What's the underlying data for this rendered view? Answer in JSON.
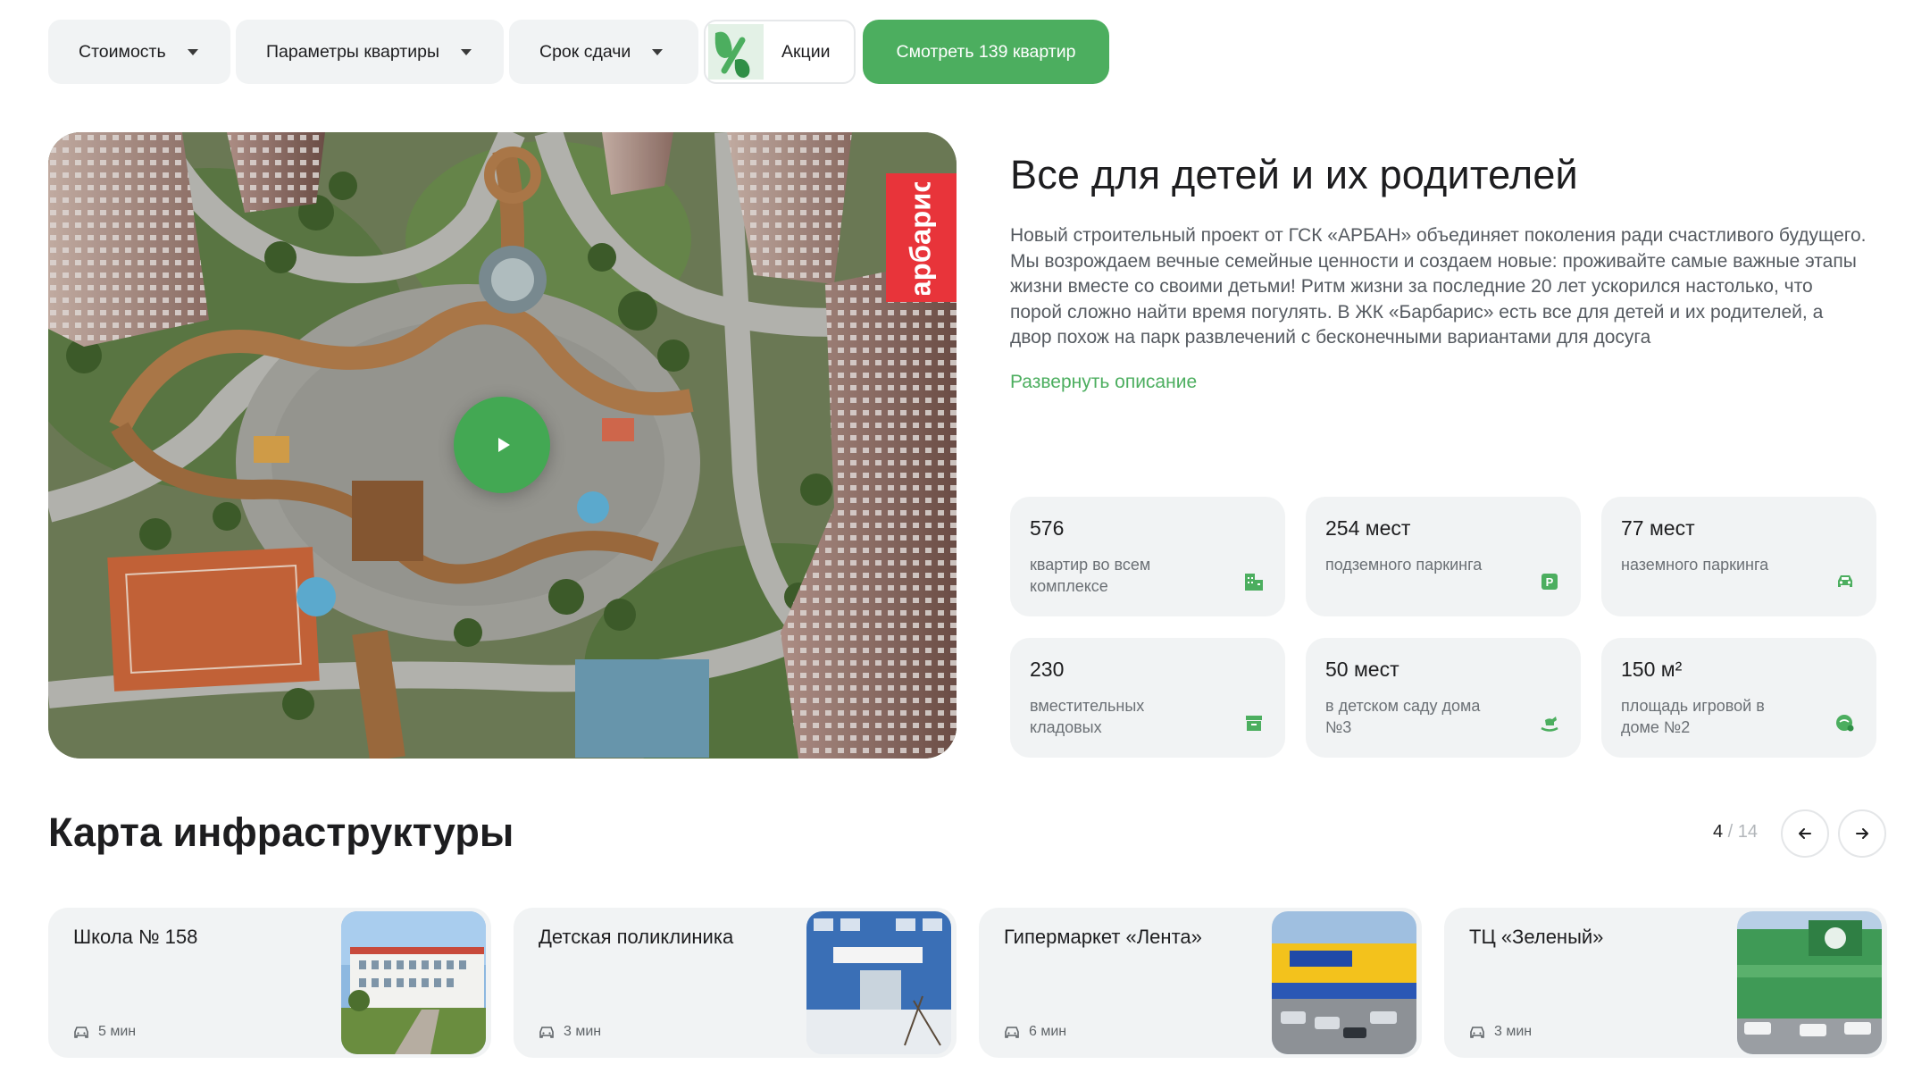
{
  "filters": {
    "cost_label": "Стоимость",
    "params_label": "Параметры квартиры",
    "term_label": "Срок сдачи",
    "promo_label": "Акции",
    "cta_label": "Смотреть 139 квартир"
  },
  "hero": {
    "brand_text": "барбарис"
  },
  "description": {
    "title": "Все для детей и их родителей",
    "body": "Новый строительный проект от ГСК «АРБАН» объединяет поколения ради счастливого будущего. Мы возрождаем вечные семейные ценности и создаем новые: проживайте самые важные этапы жизни вместе со своими детьми! Ритм жизни за последние 20 лет ускорился настолько, что порой сложно найти время погулять. В ЖК «Барбарис» есть все для детей и их родителей, а двор похож на парк развлечений с бесконечными вариантами для досуга",
    "expand_label": "Развернуть описание"
  },
  "stats": [
    {
      "value": "576",
      "label": "квартир во всем комплексе",
      "icon": "building-icon"
    },
    {
      "value": "254 мест",
      "label": "подземного паркинга",
      "icon": "parking-icon"
    },
    {
      "value": "77 мест",
      "label": "наземного паркинга",
      "icon": "car-icon"
    },
    {
      "value": "230",
      "label": "вместительных кладовых",
      "icon": "storage-icon"
    },
    {
      "value": "50 мест",
      "label": "в детском саду дома №3",
      "icon": "rocking-horse-icon"
    },
    {
      "value": "150 м²",
      "label": "площадь игровой в доме №2",
      "icon": "playground-icon"
    }
  ],
  "infrastructure": {
    "title": "Карта инфраструктуры",
    "pager_current": "4",
    "pager_sep": " / ",
    "pager_total": "14",
    "cards": [
      {
        "title": "Школа № 158",
        "time": "5 мин"
      },
      {
        "title": "Детская поликлиника",
        "time": "3 мин"
      },
      {
        "title": "Гипермаркет «Лента»",
        "time": "6 мин"
      },
      {
        "title": "ТЦ «Зеленый»",
        "time": "3 мин"
      }
    ]
  },
  "colors": {
    "accent": "#4cae5f",
    "card_bg": "#f1f3f4",
    "brand_red": "#e8343a"
  }
}
